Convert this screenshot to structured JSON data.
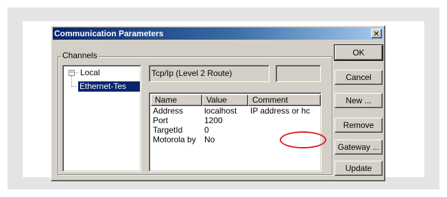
{
  "dialog": {
    "title": "Communication Parameters",
    "close_glyph": "✕"
  },
  "channels": {
    "group_label": "Channels",
    "tree": {
      "root": {
        "expander": "−",
        "label": "Local"
      },
      "child": {
        "label": "Ethernet-Tes",
        "selected": true
      }
    }
  },
  "route": {
    "label": "Tcp/Ip (Level 2 Route)",
    "extra": ""
  },
  "params": {
    "columns": [
      "Name",
      "Value",
      "Comment"
    ],
    "rows": [
      {
        "name": "Address",
        "value": "localhost",
        "comment": "IP address or hc"
      },
      {
        "name": "Port",
        "value": "1200",
        "comment": ""
      },
      {
        "name": "TargetId",
        "value": "0",
        "comment": ""
      },
      {
        "name": "Motorola by",
        "value": "No",
        "comment": ""
      }
    ]
  },
  "buttons": {
    "ok": "OK",
    "cancel": "Cancel",
    "new": "New ...",
    "remove": "Remove",
    "gateway": "Gateway ...",
    "update": "Update"
  },
  "colors": {
    "title_bar_start": "#0a246a",
    "title_bar_end": "#a6caf0",
    "dialog_face": "#d4d0c8",
    "selection": "#0a246a",
    "annotation": "#e01818"
  }
}
